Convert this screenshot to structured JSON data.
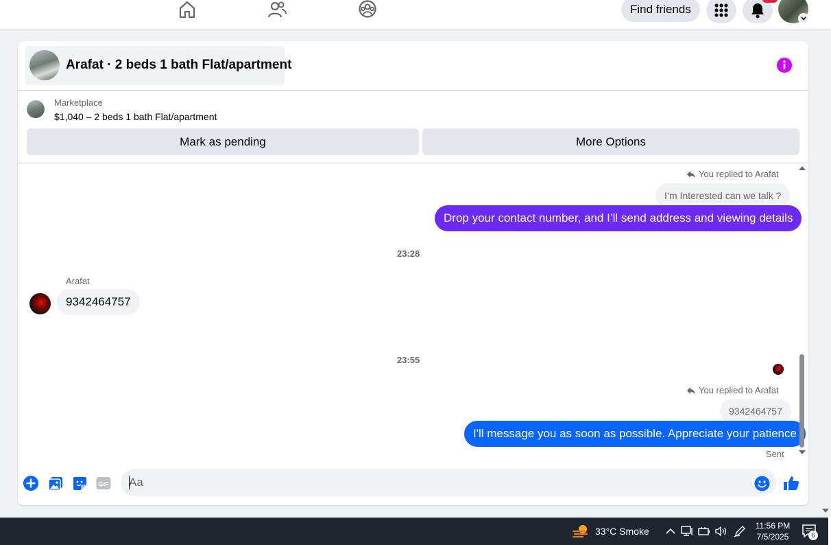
{
  "topnav": {
    "find_friends_label": "Find friends",
    "icons": [
      "home-icon",
      "friends-icon",
      "groups-icon",
      "menu-grid-icon",
      "bell-icon"
    ]
  },
  "chat": {
    "title": "Arafat · 2 beds 1 bath Flat/apartment",
    "info_color": "#d400ff",
    "marketplace": {
      "label": "Marketplace",
      "listing": "$1,040 – 2 beds 1 bath Flat/apartment",
      "mark_pending_label": "Mark as pending",
      "more_options_label": "More Options"
    },
    "messages": {
      "reply_1_label": "You replied to Arafat",
      "quoted_1": "I’m Interested can we talk ?",
      "outgoing_1": "Drop your contact number, and I’ll send address and viewing details",
      "outgoing_1_color": "#6b2bf5",
      "time_1": "23:28",
      "sender_name": "Arafat",
      "incoming_1": "9342464757",
      "time_2": "23:55",
      "reply_2_label": "You replied to Arafat",
      "quoted_2": "9342464757",
      "outgoing_2": "I'll message you as soon as possible. Appreciate your patience",
      "outgoing_2_color": "#0866ff",
      "status": "Sent"
    },
    "composer": {
      "placeholder": "Aa",
      "accent": "#0866ff"
    }
  },
  "taskbar": {
    "weather": "33°C  Smoke",
    "time": "11:56 PM",
    "date": "7/5/2025",
    "notification_count": "6"
  }
}
